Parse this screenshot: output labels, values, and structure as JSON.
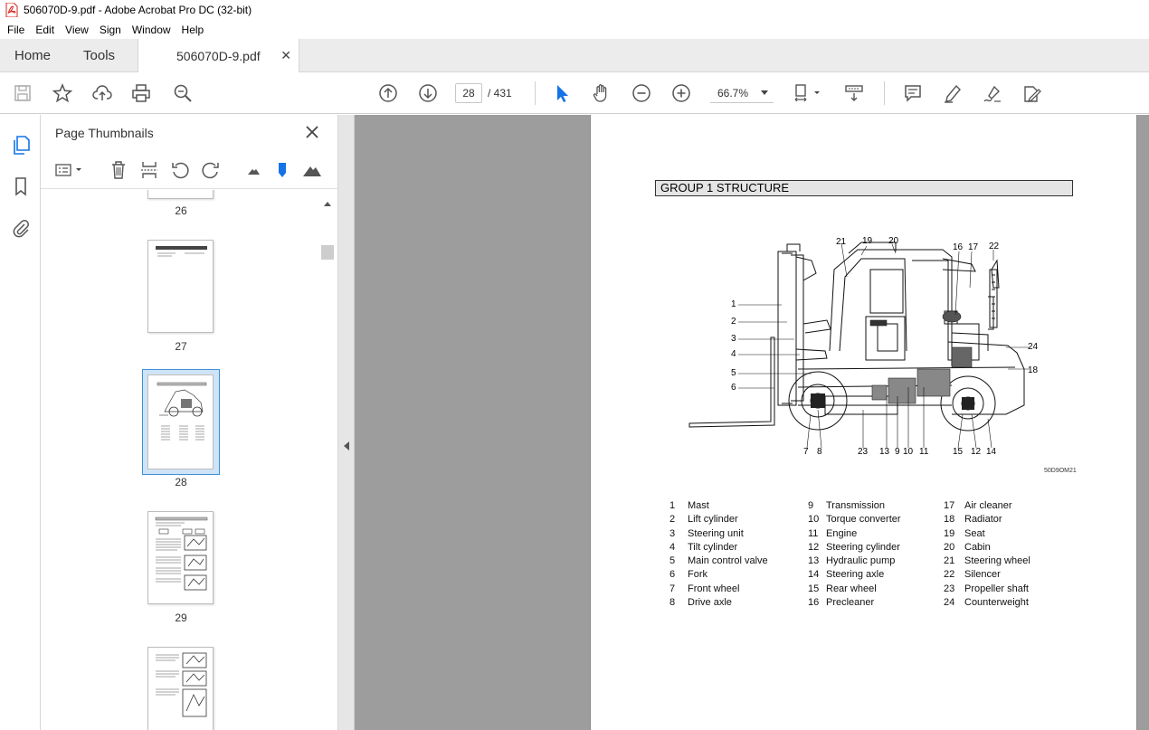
{
  "window": {
    "title": "506070D-9.pdf - Adobe Acrobat Pro DC (32-bit)"
  },
  "menu": [
    "File",
    "Edit",
    "View",
    "Sign",
    "Window",
    "Help"
  ],
  "tabs": {
    "home": "Home",
    "tools": "Tools",
    "document": "506070D-9.pdf"
  },
  "toolbar": {
    "current_page": "28",
    "total_pages": "/ 431",
    "zoom": "66.7%"
  },
  "thumbnails_panel": {
    "title": "Page Thumbnails",
    "pages": [
      "26",
      "27",
      "28",
      "29"
    ],
    "selected_page": "28"
  },
  "document": {
    "heading": "GROUP  1  STRUCTURE",
    "figure_code": "50D9OM21",
    "callouts": [
      "1",
      "2",
      "3",
      "4",
      "5",
      "6",
      "7",
      "8",
      "9",
      "10",
      "11",
      "12",
      "13",
      "14",
      "15",
      "16",
      "17",
      "18",
      "19",
      "20",
      "21",
      "22",
      "23",
      "24"
    ],
    "legend": [
      [
        {
          "num": "1",
          "label": "Mast"
        },
        {
          "num": "2",
          "label": "Lift cylinder"
        },
        {
          "num": "3",
          "label": "Steering unit"
        },
        {
          "num": "4",
          "label": "Tilt cylinder"
        },
        {
          "num": "5",
          "label": "Main control valve"
        },
        {
          "num": "6",
          "label": "Fork"
        },
        {
          "num": "7",
          "label": "Front wheel"
        },
        {
          "num": "8",
          "label": "Drive axle"
        }
      ],
      [
        {
          "num": "9",
          "label": "Transmission"
        },
        {
          "num": "10",
          "label": "Torque converter"
        },
        {
          "num": "11",
          "label": "Engine"
        },
        {
          "num": "12",
          "label": "Steering cylinder"
        },
        {
          "num": "13",
          "label": "Hydraulic pump"
        },
        {
          "num": "14",
          "label": "Steering axle"
        },
        {
          "num": "15",
          "label": "Rear wheel"
        },
        {
          "num": "16",
          "label": "Precleaner"
        }
      ],
      [
        {
          "num": "17",
          "label": "Air cleaner"
        },
        {
          "num": "18",
          "label": "Radiator"
        },
        {
          "num": "19",
          "label": "Seat"
        },
        {
          "num": "20",
          "label": "Cabin"
        },
        {
          "num": "21",
          "label": "Steering wheel"
        },
        {
          "num": "22",
          "label": "Silencer"
        },
        {
          "num": "23",
          "label": "Propeller shaft"
        },
        {
          "num": "24",
          "label": "Counterweight"
        }
      ]
    ]
  },
  "colors": {
    "accent": "#1473e6",
    "pdf_icon": "#d9261c",
    "doc_background": "#9d9d9d"
  }
}
